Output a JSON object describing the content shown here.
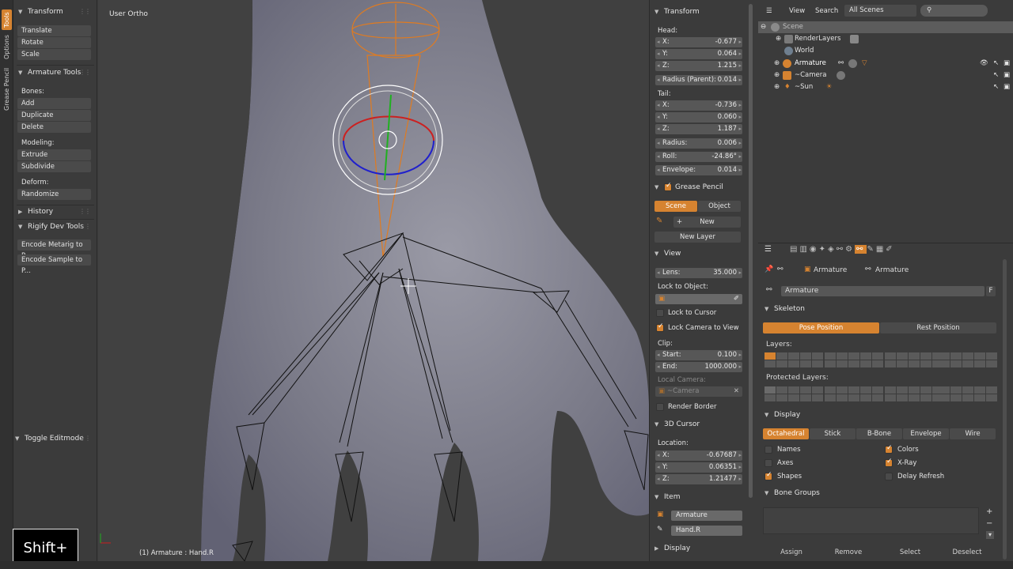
{
  "toolbar_tabs": [
    "Tools",
    "Options",
    "Grease Pencil"
  ],
  "toolshelf": {
    "transform": {
      "title": "Transform",
      "buttons": [
        "Translate",
        "Rotate",
        "Scale"
      ]
    },
    "armature_tools": {
      "title": "Armature Tools",
      "bones_label": "Bones:",
      "bones": [
        "Add",
        "Duplicate",
        "Delete"
      ],
      "modeling_label": "Modeling:",
      "modeling": [
        "Extrude",
        "Subdivide"
      ],
      "deform_label": "Deform:",
      "deform": [
        "Randomize"
      ]
    },
    "history": "History",
    "rigify": {
      "title": "Rigify Dev Tools",
      "buttons": [
        "Encode Metarig to P...",
        "Encode Sample to P..."
      ]
    },
    "toggle_editmode": "Toggle Editmode"
  },
  "viewport": {
    "label": "User Ortho",
    "status": "(1) Armature : Hand.R",
    "keycast": "Shift+"
  },
  "npanel": {
    "transform_title": "Transform",
    "head_label": "Head:",
    "head": [
      {
        "k": "X:",
        "v": "-0.677"
      },
      {
        "k": "Y:",
        "v": "0.064"
      },
      {
        "k": "Z:",
        "v": "1.215"
      }
    ],
    "radius_parent": {
      "k": "Radius (Parent):",
      "v": "0.014"
    },
    "tail_label": "Tail:",
    "tail": [
      {
        "k": "X:",
        "v": "-0.736"
      },
      {
        "k": "Y:",
        "v": "0.060"
      },
      {
        "k": "Z:",
        "v": "1.187"
      }
    ],
    "radius": {
      "k": "Radius:",
      "v": "0.006"
    },
    "roll": {
      "k": "Roll:",
      "v": "-24.86°"
    },
    "envelope": {
      "k": "Envelope:",
      "v": "0.014"
    },
    "grease_title": "Grease Pencil",
    "grease_scene": "Scene",
    "grease_object": "Object",
    "grease_new": "New",
    "grease_new_layer": "New Layer",
    "view_title": "View",
    "lens": {
      "k": "Lens:",
      "v": "35.000"
    },
    "lock_to_object": "Lock to Object:",
    "lock_to_cursor": "Lock to Cursor",
    "lock_camera": "Lock Camera to View",
    "clip_label": "Clip:",
    "clip_start": {
      "k": "Start:",
      "v": "0.100"
    },
    "clip_end": {
      "k": "End:",
      "v": "1000.000"
    },
    "local_camera": "Local Camera:",
    "local_camera_value": "~Camera",
    "render_border": "Render Border",
    "cursor_title": "3D Cursor",
    "location_label": "Location:",
    "cursor": [
      {
        "k": "X:",
        "v": "-0.67687"
      },
      {
        "k": "Y:",
        "v": "0.06351"
      },
      {
        "k": "Z:",
        "v": "1.21477"
      }
    ],
    "item_title": "Item",
    "item_object": "Armature",
    "item_bone": "Hand.R",
    "display_title": "Display"
  },
  "outliner": {
    "view": "View",
    "search": "Search",
    "scenes": "All Scenes",
    "rows": [
      "Scene",
      "RenderLayers",
      "World",
      "Armature",
      "~Camera",
      "~Sun"
    ]
  },
  "properties": {
    "crumb1": "Armature",
    "crumb2": "Armature",
    "name_field": "Armature",
    "name_f": "F",
    "skeleton_title": "Skeleton",
    "pose_position": "Pose Position",
    "rest_position": "Rest Position",
    "layers_label": "Layers:",
    "protected_label": "Protected Layers:",
    "display_title": "Display",
    "display_modes": [
      "Octahedral",
      "Stick",
      "B-Bone",
      "Envelope",
      "Wire"
    ],
    "names": "Names",
    "axes": "Axes",
    "shapes": "Shapes",
    "colors": "Colors",
    "xray": "X-Ray",
    "delay_refresh": "Delay Refresh",
    "bone_groups_title": "Bone Groups",
    "bg_buttons": [
      "Assign",
      "Remove",
      "Select",
      "Deselect"
    ]
  },
  "colors": {
    "accent": "#d68330",
    "panel": "#3b3b3b",
    "field": "#575757"
  }
}
